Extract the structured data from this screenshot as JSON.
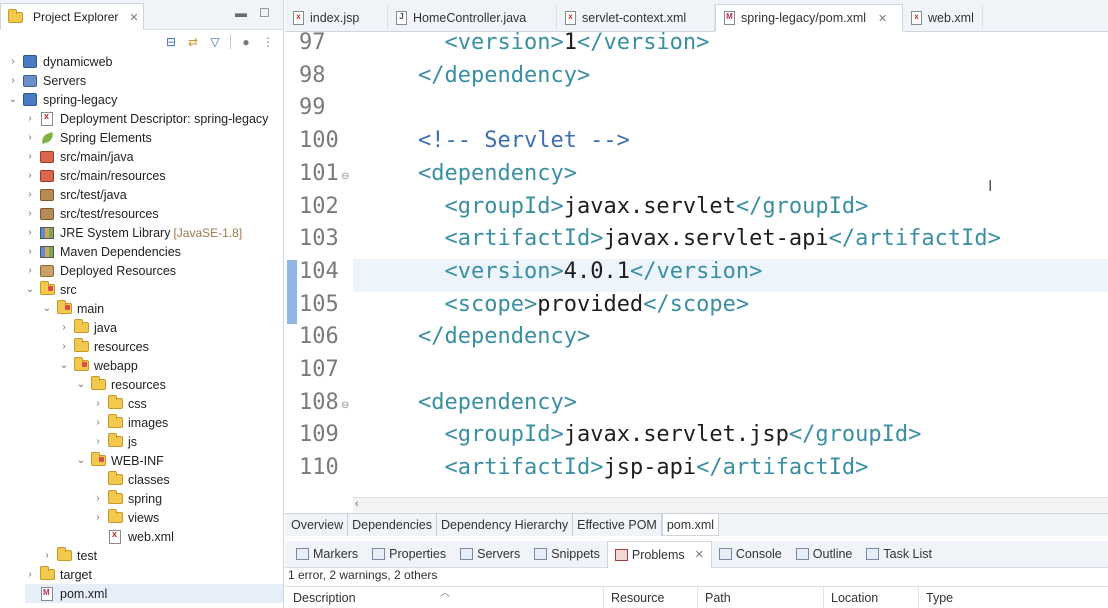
{
  "explorer": {
    "title": "Project Explorer",
    "close_icon": "close-icon",
    "tree": [
      {
        "label": "dynamicweb",
        "indent": 0,
        "chevron": "›",
        "icon": "project"
      },
      {
        "label": "Servers",
        "indent": 0,
        "chevron": "›",
        "icon": "servers"
      },
      {
        "label": "spring-legacy",
        "indent": 0,
        "chevron": "⌄",
        "icon": "project"
      },
      {
        "label": "Deployment Descriptor: spring-legacy",
        "indent": 1,
        "chevron": "›",
        "icon": "descriptor"
      },
      {
        "label": "Spring Elements",
        "indent": 1,
        "chevron": "›",
        "icon": "spring"
      },
      {
        "label": "src/main/java",
        "indent": 1,
        "chevron": "›",
        "icon": "pkg-red"
      },
      {
        "label": "src/main/resources",
        "indent": 1,
        "chevron": "›",
        "icon": "pkg-red"
      },
      {
        "label": "src/test/java",
        "indent": 1,
        "chevron": "›",
        "icon": "pkg"
      },
      {
        "label": "src/test/resources",
        "indent": 1,
        "chevron": "›",
        "icon": "pkg"
      },
      {
        "label": "JRE System Library",
        "suffix": "[JavaSE-1.8]",
        "indent": 1,
        "chevron": "›",
        "icon": "library"
      },
      {
        "label": "Maven Dependencies",
        "indent": 1,
        "chevron": "›",
        "icon": "library"
      },
      {
        "label": "Deployed Resources",
        "indent": 1,
        "chevron": "›",
        "icon": "deployed"
      },
      {
        "label": "src",
        "indent": 1,
        "chevron": "⌄",
        "icon": "folder-src"
      },
      {
        "label": "main",
        "indent": 2,
        "chevron": "⌄",
        "icon": "folder-src"
      },
      {
        "label": "java",
        "indent": 3,
        "chevron": "›",
        "icon": "folder"
      },
      {
        "label": "resources",
        "indent": 3,
        "chevron": "›",
        "icon": "folder"
      },
      {
        "label": "webapp",
        "indent": 3,
        "chevron": "⌄",
        "icon": "folder-src"
      },
      {
        "label": "resources",
        "indent": 4,
        "chevron": "⌄",
        "icon": "folder"
      },
      {
        "label": "css",
        "indent": 5,
        "chevron": "›",
        "icon": "folder"
      },
      {
        "label": "images",
        "indent": 5,
        "chevron": "›",
        "icon": "folder"
      },
      {
        "label": "js",
        "indent": 5,
        "chevron": "›",
        "icon": "folder"
      },
      {
        "label": "WEB-INF",
        "indent": 4,
        "chevron": "⌄",
        "icon": "folder-src"
      },
      {
        "label": "classes",
        "indent": 5,
        "chevron": "",
        "icon": "folder"
      },
      {
        "label": "spring",
        "indent": 5,
        "chevron": "›",
        "icon": "folder"
      },
      {
        "label": "views",
        "indent": 5,
        "chevron": "›",
        "icon": "folder"
      },
      {
        "label": "web.xml",
        "indent": 5,
        "chevron": "",
        "icon": "xml"
      },
      {
        "label": "test",
        "indent": 2,
        "chevron": "›",
        "icon": "folder"
      },
      {
        "label": "target",
        "indent": 1,
        "chevron": "›",
        "icon": "folder"
      },
      {
        "label": "pom.xml",
        "indent": 1,
        "chevron": "",
        "icon": "maven",
        "selected": true
      }
    ]
  },
  "editor": {
    "tabs": [
      {
        "label": "index.jsp",
        "icon": "jsp-file-icon",
        "active": false
      },
      {
        "label": "HomeController.java",
        "icon": "java-file-icon",
        "active": false
      },
      {
        "label": "servlet-context.xml",
        "icon": "xml-file-icon",
        "active": false
      },
      {
        "label": "spring-legacy/pom.xml",
        "icon": "maven-file-icon",
        "active": true,
        "close": "✕"
      },
      {
        "label": "web.xml",
        "icon": "xml-file-icon",
        "active": false
      }
    ],
    "lines": [
      {
        "num": "97",
        "indent": 6,
        "parts": [
          [
            "tg",
            "<version>"
          ],
          [
            "tx",
            "1"
          ],
          [
            "tg",
            "</version>"
          ]
        ]
      },
      {
        "num": "98",
        "indent": 4,
        "parts": [
          [
            "tg",
            "</dependency>"
          ]
        ]
      },
      {
        "num": "99",
        "indent": 0,
        "parts": []
      },
      {
        "num": "100",
        "indent": 4,
        "parts": [
          [
            "cm",
            "<!-- Servlet -->"
          ]
        ]
      },
      {
        "num": "101",
        "indent": 4,
        "fold": true,
        "parts": [
          [
            "tg",
            "<dependency>"
          ]
        ]
      },
      {
        "num": "102",
        "indent": 6,
        "parts": [
          [
            "tg",
            "<groupId>"
          ],
          [
            "tx",
            "javax.servlet"
          ],
          [
            "tg",
            "</groupId>"
          ]
        ]
      },
      {
        "num": "103",
        "indent": 6,
        "parts": [
          [
            "tg",
            "<artifactId>"
          ],
          [
            "tx",
            "javax.servlet-api"
          ],
          [
            "tg",
            "</artifactId>"
          ]
        ]
      },
      {
        "num": "104",
        "indent": 6,
        "parts": [
          [
            "tg",
            "<version>"
          ],
          [
            "tx",
            "4.0.1"
          ],
          [
            "tg",
            "</version>"
          ]
        ]
      },
      {
        "num": "105",
        "indent": 6,
        "parts": [
          [
            "tg",
            "<scope>"
          ],
          [
            "tx",
            "provided"
          ],
          [
            "tg",
            "</scope>"
          ]
        ]
      },
      {
        "num": "106",
        "indent": 4,
        "parts": [
          [
            "tg",
            "</dependency>"
          ]
        ]
      },
      {
        "num": "107",
        "indent": 0,
        "parts": []
      },
      {
        "num": "108",
        "indent": 4,
        "fold": true,
        "parts": [
          [
            "tg",
            "<dependency>"
          ]
        ]
      },
      {
        "num": "109",
        "indent": 6,
        "parts": [
          [
            "tg",
            "<groupId>"
          ],
          [
            "tx",
            "javax.servlet.jsp"
          ],
          [
            "tg",
            "</groupId>"
          ]
        ]
      },
      {
        "num": "110",
        "indent": 6,
        "parts": [
          [
            "tg",
            "<artifactId>"
          ],
          [
            "tx",
            "jsp-api"
          ],
          [
            "tg",
            "</artifactId>"
          ]
        ]
      }
    ],
    "pom_tabs": [
      {
        "label": "Overview",
        "active": false
      },
      {
        "label": "Dependencies",
        "active": false
      },
      {
        "label": "Dependency Hierarchy",
        "active": false
      },
      {
        "label": "Effective POM",
        "active": false
      },
      {
        "label": "pom.xml",
        "active": true
      }
    ]
  },
  "bottom": {
    "tabs": [
      {
        "label": "Markers",
        "icon": "markers-icon",
        "active": false
      },
      {
        "label": "Properties",
        "icon": "properties-icon",
        "active": false
      },
      {
        "label": "Servers",
        "icon": "servers-icon",
        "active": false
      },
      {
        "label": "Snippets",
        "icon": "snippets-icon",
        "active": false
      },
      {
        "label": "Problems",
        "icon": "problems-icon",
        "active": true,
        "close": "✕"
      },
      {
        "label": "Console",
        "icon": "console-icon",
        "active": false
      },
      {
        "label": "Outline",
        "icon": "outline-icon",
        "active": false
      },
      {
        "label": "Task List",
        "icon": "task-list-icon",
        "active": false
      }
    ],
    "summary": "1 error, 2 warnings, 2 others",
    "columns": [
      "Description",
      "Resource",
      "Path",
      "Location",
      "Type"
    ]
  }
}
